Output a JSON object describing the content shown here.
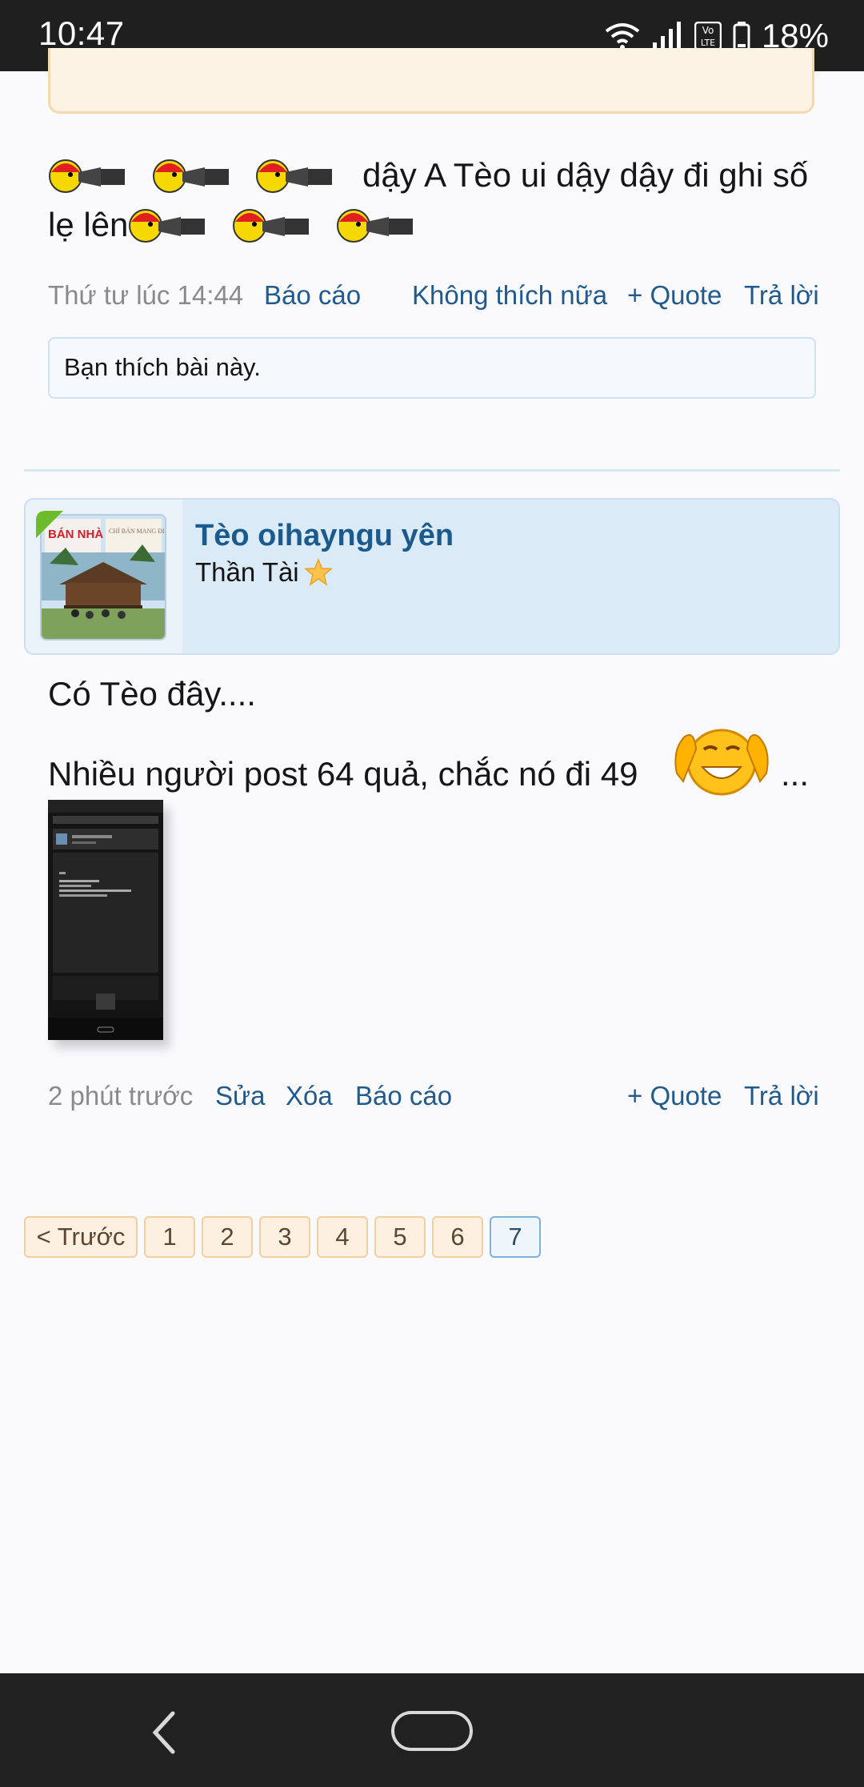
{
  "status_bar": {
    "time": "10:47",
    "battery": "18%",
    "icons": [
      "wifi-icon",
      "signal-icon",
      "volte-icon",
      "battery-icon"
    ]
  },
  "post1": {
    "line1_text": "dậy A Tèo ui dậy dậy đi ghi số",
    "line2_text": "lẹ lên",
    "timestamp": "Thứ tư lúc 14:44",
    "report": "Báo cáo",
    "unlike": "Không thích nữa",
    "quote": "+ Quote",
    "reply": "Trả lời",
    "likes_text": "Bạn thích bài này."
  },
  "post2": {
    "author": "Tèo oihayngu yên",
    "author_title": "Thần Tài",
    "avatar_sign_left": "BÁN NHÀ",
    "avatar_sign_right": "CHỈ BÁN MANG ĐI",
    "line1": "Có Tèo đây....",
    "line2": "Nhiều người post 64 quả, chắc nó đi 49",
    "line2_suffix": "...",
    "timestamp": "2 phút trước",
    "edit": "Sửa",
    "delete": "Xóa",
    "report": "Báo cáo",
    "quote": "+ Quote",
    "reply": "Trả lời"
  },
  "pagination": {
    "prev": "< Trước",
    "pages": [
      "1",
      "2",
      "3",
      "4",
      "5",
      "6",
      "7"
    ],
    "current": "7"
  },
  "colors": {
    "link": "#215a8d",
    "username": "#1a5a8c",
    "status_bar": "#1f1f1f",
    "page_bg": "#fafafd"
  }
}
